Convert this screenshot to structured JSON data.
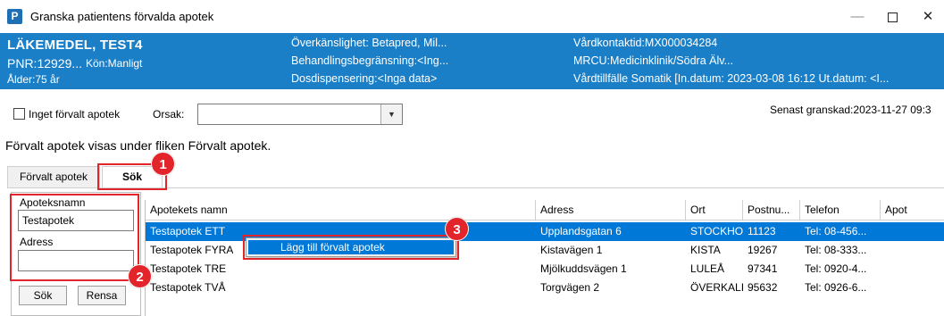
{
  "window": {
    "app_icon_letter": "P",
    "title": "Granska patientens förvalda apotek",
    "minimize_glyph": "—",
    "close_glyph": "✕"
  },
  "patient": {
    "name": "LÄKEMEDEL, TEST4",
    "pnr": "PNR:12929...",
    "kon": "Kön:Manligt",
    "alder": "Ålder:75 år",
    "overkanslighet": "Överkänslighet: Betapred, Mil...",
    "behandlingsbegransning": "Behandlingsbegränsning:<Ing...",
    "dosdispensering": "Dosdispensering:<Inga data>",
    "vardkontakt": "Vårdkontaktid:MX000034284",
    "mrcu": "MRCU:Medicinklinik/Södra Älv...",
    "vardtillfalle": "Vårdtillfälle Somatik [In.datum: 2023-03-08 16:12 Ut.datum: <I..."
  },
  "options": {
    "inget_forvalt_label": "Inget förvalt apotek",
    "inget_forvalt_checked": false,
    "orsak_label": "Orsak:",
    "orsak_value": "",
    "senast_granskad": "Senast granskad:2023-11-27 09:3"
  },
  "info_text": "Förvalt apotek visas under fliken Förvalt apotek.",
  "tabs": [
    {
      "label": "Förvalt apotek",
      "active": false
    },
    {
      "label": "Sök",
      "active": true
    }
  ],
  "search": {
    "namn_label": "Apoteksnamn",
    "namn_value": "Testapotek",
    "adress_label": "Adress",
    "adress_value": "",
    "sok_button": "Sök",
    "rensa_button": "Rensa"
  },
  "grid": {
    "columns": [
      "Apotekets namn",
      "Adress",
      "Ort",
      "Postnu...",
      "Telefon",
      "Apot"
    ],
    "rows": [
      {
        "namn": "Testapotek ETT",
        "adress": "Upplandsgatan 6",
        "ort": "STOCKHOL...",
        "postnr": "11123",
        "telefon": "Tel: 08-456...",
        "selected": true
      },
      {
        "namn": "Testapotek FYRA",
        "adress": "Kistavägen 1",
        "ort": "KISTA",
        "postnr": "19267",
        "telefon": "Tel: 08-333...",
        "selected": false
      },
      {
        "namn": "Testapotek TRE",
        "adress": "Mjölkuddsvägen 1",
        "ort": "LULEÅ",
        "postnr": "97341",
        "telefon": "Tel: 0920-4...",
        "selected": false
      },
      {
        "namn": "Testapotek TVÅ",
        "adress": "Torgvägen 2",
        "ort": "ÖVERKALIX",
        "postnr": "95632",
        "telefon": "Tel: 0926-6...",
        "selected": false
      }
    ]
  },
  "context_menu": {
    "item": "Lägg till förvalt apotek"
  },
  "annotations": {
    "badge_1": "1",
    "badge_2": "2",
    "badge_3": "3",
    "color": "#e3242b"
  },
  "colors": {
    "patient_header_bg": "#1b7fc8",
    "selection": "#0078d7"
  }
}
